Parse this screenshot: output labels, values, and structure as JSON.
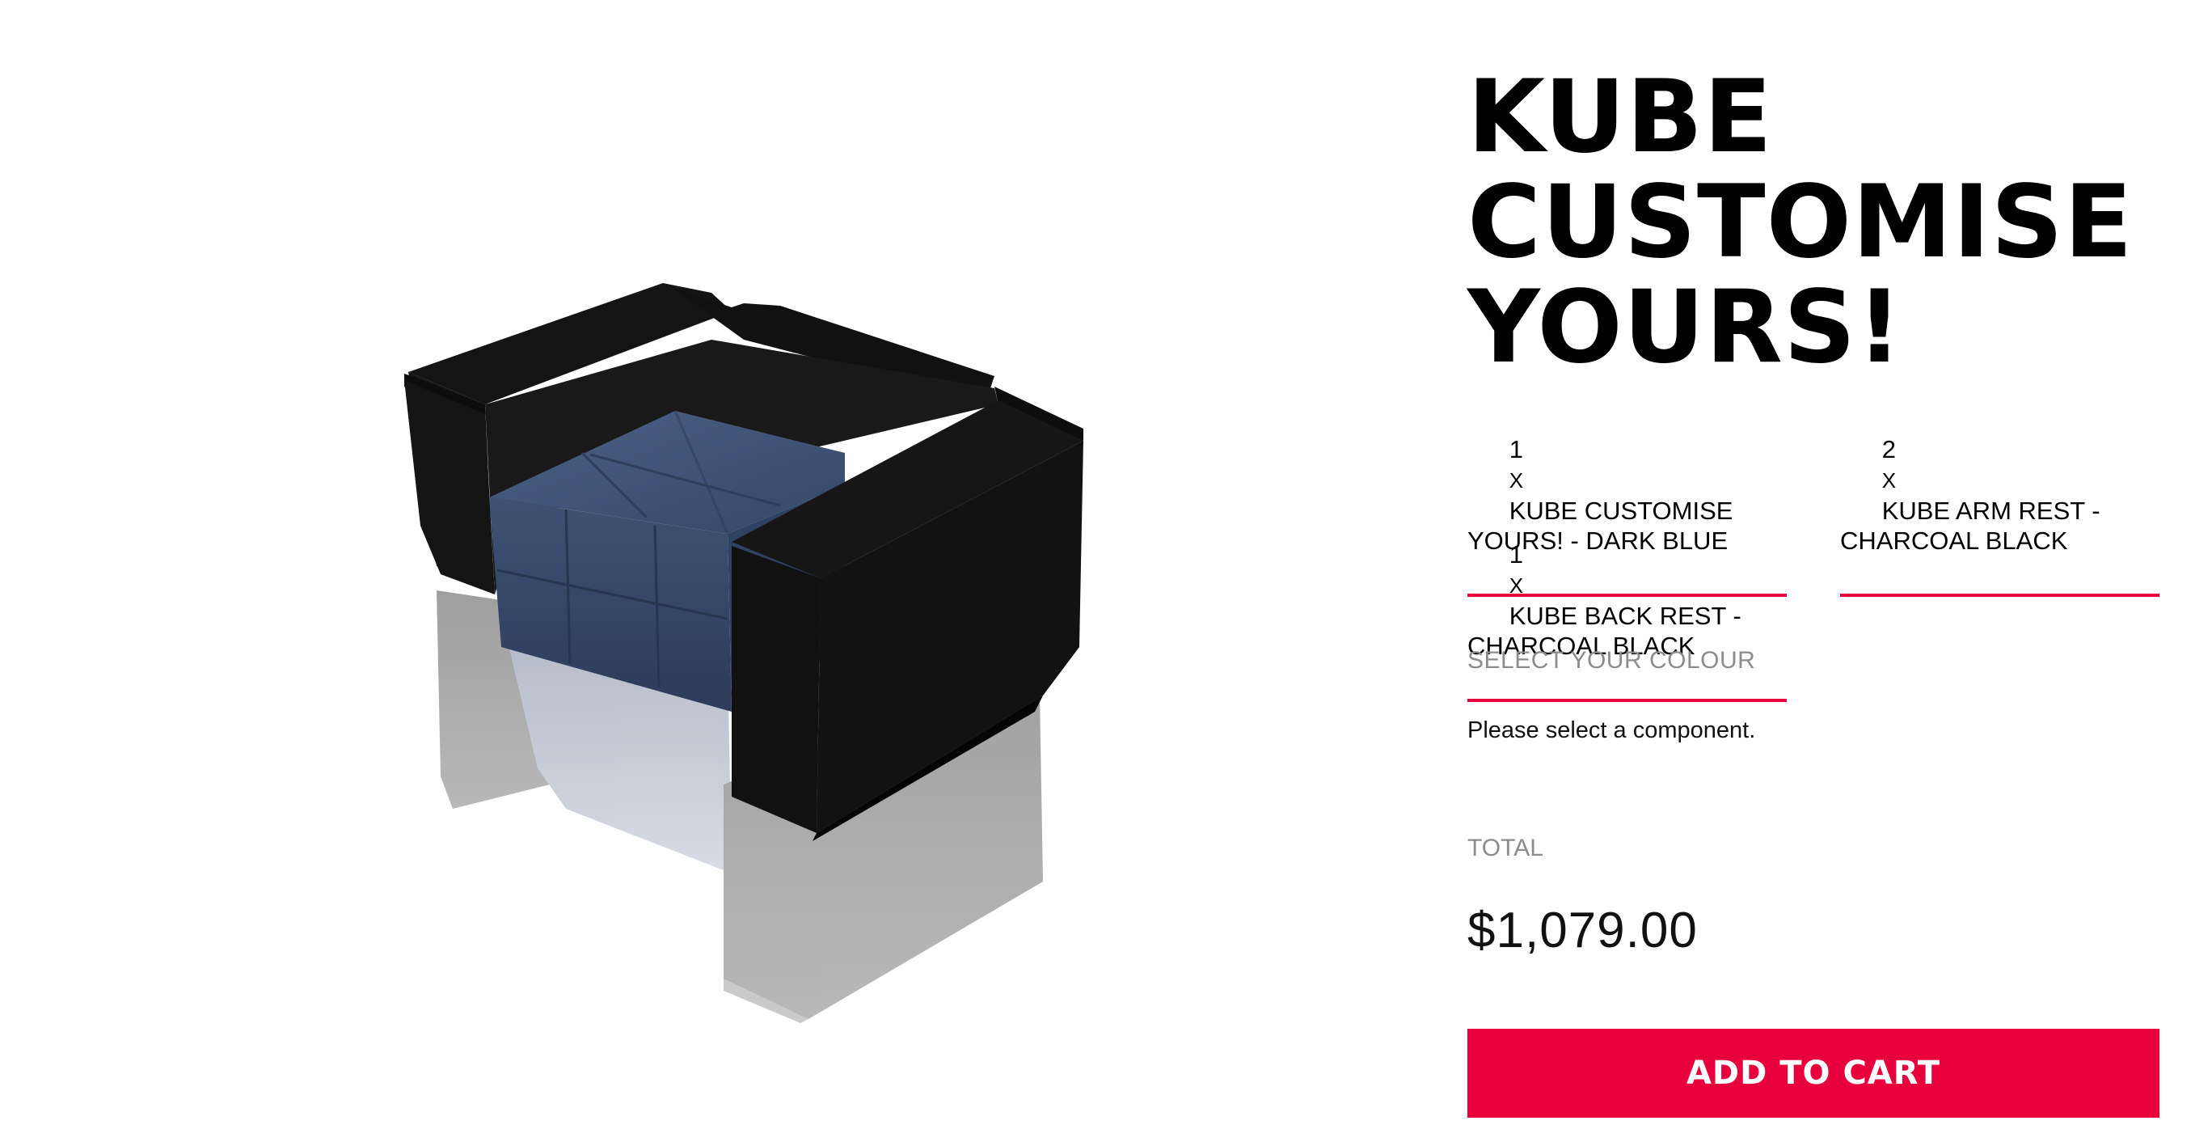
{
  "product": {
    "title_lines": [
      "KUBE",
      "CUSTOMISE",
      "YOURS!"
    ]
  },
  "components": [
    {
      "qty": "1",
      "x": "x",
      "name": "KUBE CUSTOMISE YOURS! - DARK BLUE"
    },
    {
      "qty": "2",
      "x": "x",
      "name": "KUBE ARM REST - CHARCOAL BLACK"
    },
    {
      "qty": "1",
      "x": "x",
      "name": "KUBE BACK REST - CHARCOAL BLACK"
    }
  ],
  "colour": {
    "label": "SELECT YOUR COLOUR",
    "message": "Please select a component."
  },
  "total": {
    "label": "TOTAL",
    "value": "$1,079.00"
  },
  "cart": {
    "button_label": "ADD TO CART"
  },
  "colors": {
    "accent": "#e8003d",
    "seat_fabric": "#3e5374",
    "frame": "#1a1a1a"
  }
}
